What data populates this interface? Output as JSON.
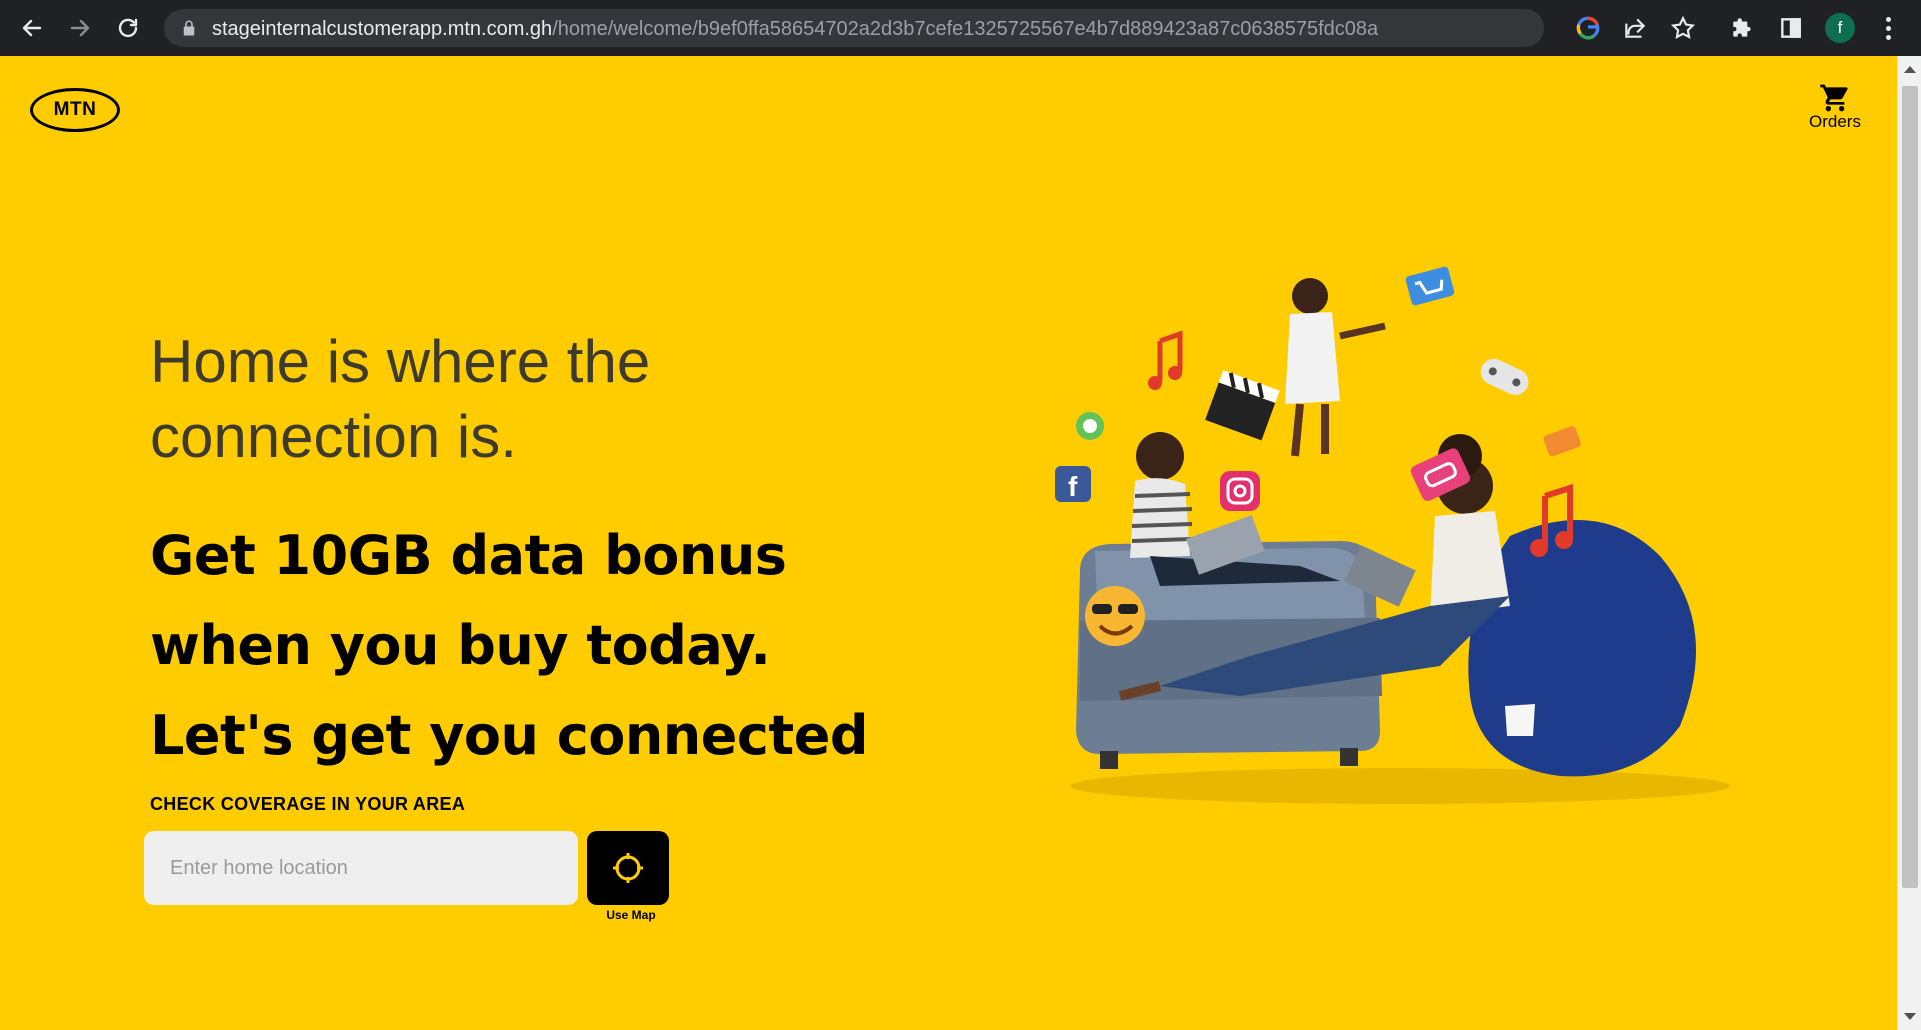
{
  "browser": {
    "url_host": "stageinternalcustomerapp.mtn.com.gh",
    "url_path": "/home/welcome/b9ef0ffa58654702a2d3b7cefe1325725567e4b7d889423a87c0638575fdc08a",
    "profile_initial": "f",
    "profile_color": "#0f6e4f"
  },
  "header": {
    "logo_text": "MTN",
    "orders_label": "Orders"
  },
  "hero": {
    "title_line1": "Home is where the",
    "title_line2": "connection is.",
    "promo_line1": "Get 10GB data bonus",
    "promo_line2": "when you buy today.",
    "promo_line3": "Let's get you connected"
  },
  "coverage": {
    "label": "CHECK COVERAGE IN YOUR AREA",
    "input_placeholder": "Enter home location",
    "input_value": "",
    "map_button_label": "Use Map"
  },
  "colors": {
    "brand_yellow": "#ffcc00",
    "brand_black": "#000000",
    "input_bg": "#efefef"
  }
}
